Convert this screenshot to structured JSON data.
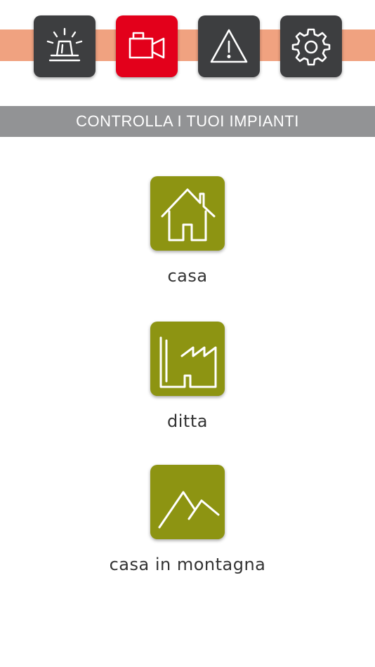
{
  "nav": {
    "items": [
      {
        "icon": "siren-icon",
        "active": false
      },
      {
        "icon": "video-camera-icon",
        "active": true
      },
      {
        "icon": "warning-icon",
        "active": false
      },
      {
        "icon": "gear-icon",
        "active": false
      }
    ]
  },
  "header": {
    "title": "CONTROLLA I TUOI IMPIANTI"
  },
  "plants": [
    {
      "label": "casa",
      "icon": "house-icon"
    },
    {
      "label": "ditta",
      "icon": "factory-icon"
    },
    {
      "label": "casa in montagna",
      "icon": "mountain-icon"
    }
  ],
  "colors": {
    "band": "#f0a280",
    "nav_button": "#3d3e40",
    "nav_active": "#e3001b",
    "title_bar": "#929395",
    "tile": "#8d9412"
  }
}
